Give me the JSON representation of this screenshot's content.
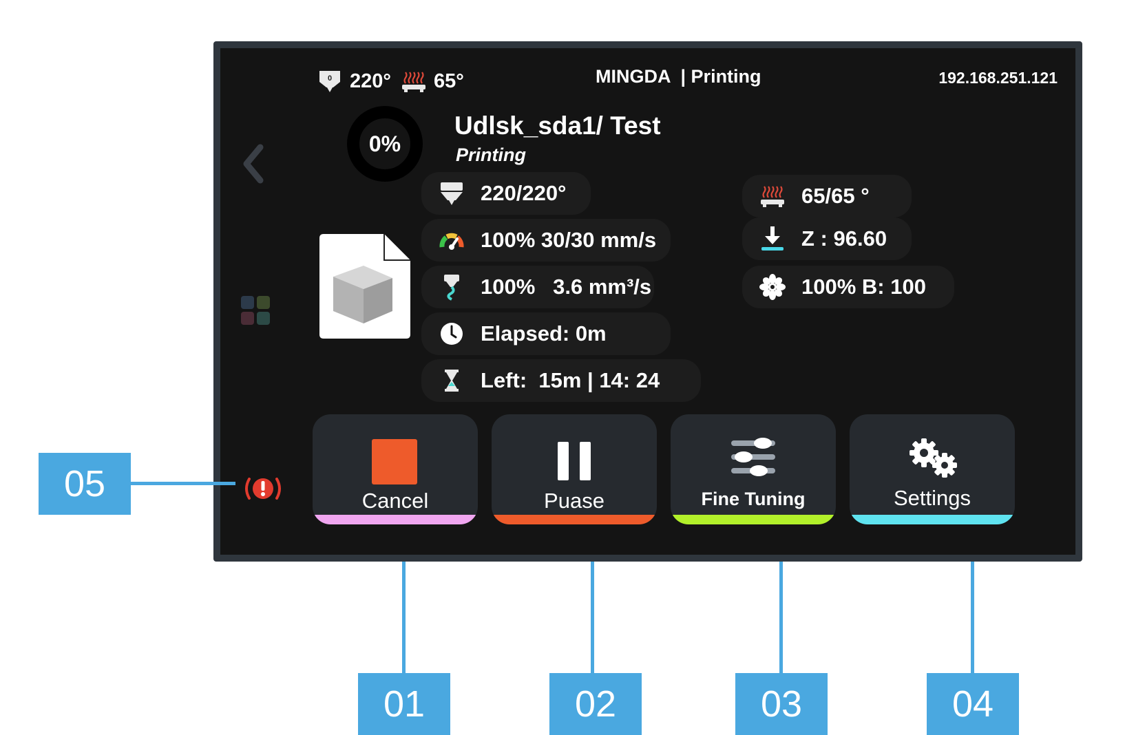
{
  "status_bar": {
    "nozzle_temp": "220°",
    "bed_temp": "65°",
    "title": "MINGDA  | Printing",
    "ip": "192.168.251.121"
  },
  "job": {
    "progress_label": "0%",
    "progress": 0,
    "file_name": "Udlsk_sda1/ Test",
    "state": "Printing"
  },
  "info_left": {
    "nozzle": "220/220°",
    "speed": "100% 30/30 mm/s",
    "flow": "100%   3.6 mm³/s",
    "elapsed": "Elapsed: 0m",
    "left": "Left:  15m | 14: 24"
  },
  "info_right": {
    "bed": "65/65 °",
    "z": "Z : 96.60",
    "fan": "100% B: 100"
  },
  "buttons": {
    "cancel": "Cancel",
    "pause": "Puase",
    "fine_tuning": "Fine Tuning",
    "settings": "Settings"
  },
  "callouts": {
    "c01": "01",
    "c02": "02",
    "c03": "03",
    "c04": "04",
    "c05": "05"
  },
  "colors": {
    "cancel_accent": "#ee5b2b",
    "cancel_bar": "#f0a6f0",
    "pause_bar": "#ee5b2b",
    "fine_bar": "#b2f02a",
    "settings_bar": "#5fe3f0",
    "callout": "#4aa8e0",
    "alert": "#e23b2e"
  },
  "icons": {
    "nozzle": "nozzle-icon",
    "bed": "heated-bed-icon",
    "speed": "speedometer-icon",
    "flow": "extruder-flow-icon",
    "clock": "clock-icon",
    "hourglass": "hourglass-icon",
    "z": "z-offset-icon",
    "fan": "fan-icon",
    "back": "chevron-left-icon",
    "apps": "apps-grid-icon",
    "alert": "emergency-stop-icon"
  }
}
